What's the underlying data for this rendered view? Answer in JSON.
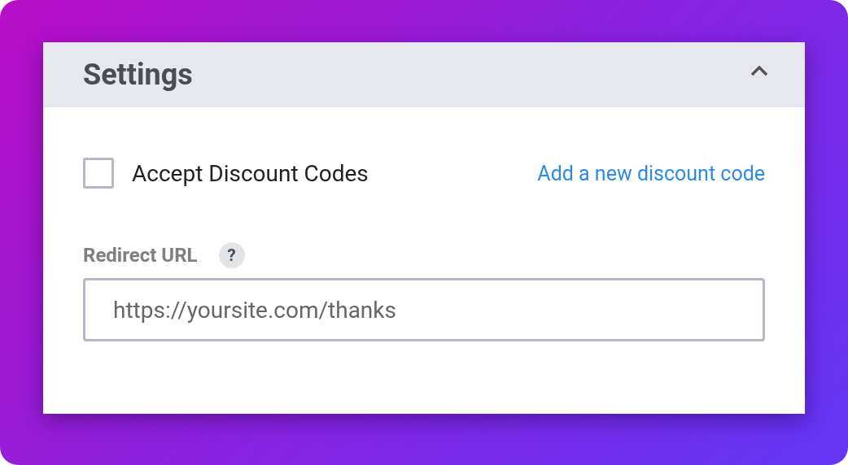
{
  "panel": {
    "title": "Settings",
    "expanded": true
  },
  "discount": {
    "label": "Accept Discount Codes",
    "checked": false,
    "link": "Add a new discount code"
  },
  "redirect": {
    "label": "Redirect URL",
    "help": "?",
    "placeholder": "https://yoursite.com/thanks"
  }
}
